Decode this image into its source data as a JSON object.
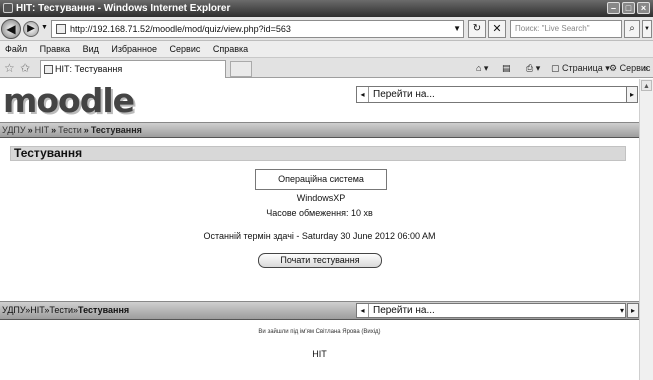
{
  "window": {
    "title": "НІТ: Тестування - Windows Internet Explorer",
    "buttons": {
      "minimize": "–",
      "maximize": "□",
      "close": "×"
    }
  },
  "addressbar": {
    "back": "◀",
    "forward": "▶",
    "dropdown": "▼",
    "url": "http://192.168.71.52/moodle/mod/quiz/view.php?id=563",
    "refresh": "↻",
    "stop": "✕",
    "search_placeholder": "Поиск: \"Live Search\"",
    "search_btn": "⌕"
  },
  "menubar": {
    "items": [
      "Файл",
      "Правка",
      "Вид",
      "Избранное",
      "Сервис",
      "Справка"
    ]
  },
  "tabbar": {
    "tab_label": "НІТ: Тестування",
    "commands": {
      "home": "⌂ ▾",
      "feeds": "▤",
      "print": "⎙ ▾",
      "page": "▢ Страница ▾",
      "tools": "⚙ Сервис ▾",
      "more": "»"
    }
  },
  "page": {
    "logo": "moodle",
    "jump_to": "Перейти на...",
    "jump_left": "◂",
    "jump_arrow": "▾",
    "jump_go": "▸",
    "breadcrumb": [
      {
        "label": "УДПУ",
        "link": true
      },
      {
        "label": "НІТ",
        "link": true
      },
      {
        "label": "Тести",
        "link": true
      },
      {
        "label": "Тестування",
        "link": false
      }
    ],
    "breadcrumb_sep": "»",
    "quiz_title": "Тестування",
    "quiz_intro": "Операційна система WindowsXP",
    "time_limit": "Часове обмеження: 10 хв",
    "close_date": "Останній термін здачі - Saturday 30 June 2012 06:00 AM",
    "start_button": "Почати тестування",
    "login_info": "Ви зайшли під ім'ям Світлана Ярова (Вихід)",
    "footer_home": "НІТ"
  },
  "colors": {
    "titlebar": "#2e2e2e",
    "navbar": "#a8a8a8",
    "heading_bg": "#d8d8d8"
  }
}
